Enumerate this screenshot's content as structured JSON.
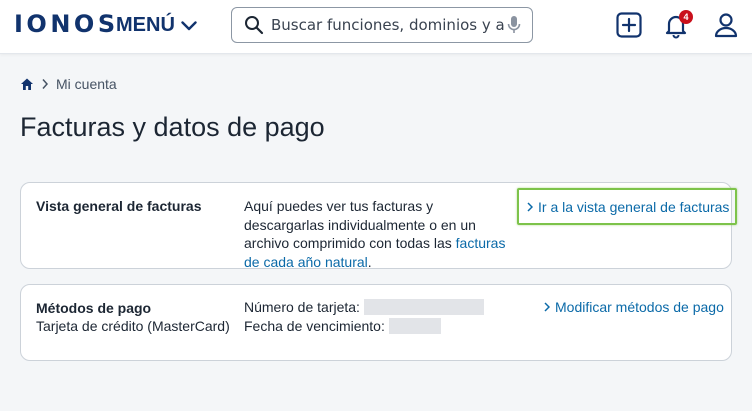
{
  "header": {
    "logo": "IONOS",
    "menu_label": "MENÚ",
    "search_placeholder": "Buscar funciones, dominios y art...",
    "notification_count": "4",
    "icons": [
      "search-icon",
      "microphone-icon",
      "add-icon",
      "bell-icon",
      "user-icon",
      "chevron-down-icon"
    ]
  },
  "breadcrumb": {
    "home_icon": "home-icon",
    "current": "Mi cuenta"
  },
  "page": {
    "title": "Facturas y datos de pago"
  },
  "invoices": {
    "label": "Vista general de facturas",
    "description_before": "Aquí puedes ver tus facturas y descargarlas individualmente o en un archivo comprimido con todas las ",
    "description_link": "facturas de cada año natural",
    "description_after": ".",
    "action": "Ir a la vista general de facturas"
  },
  "payment": {
    "label": "Métodos de pago",
    "method": "Tarjeta de crédito (MasterCard)",
    "card_number_label": "Número de tarjeta:",
    "expiry_label": "Fecha de vencimiento:",
    "action": "Modificar métodos de pago"
  },
  "colors": {
    "brand": "#11336d",
    "link": "#0b6aa8",
    "highlight": "#7dc34a",
    "badge": "#c9101c"
  }
}
